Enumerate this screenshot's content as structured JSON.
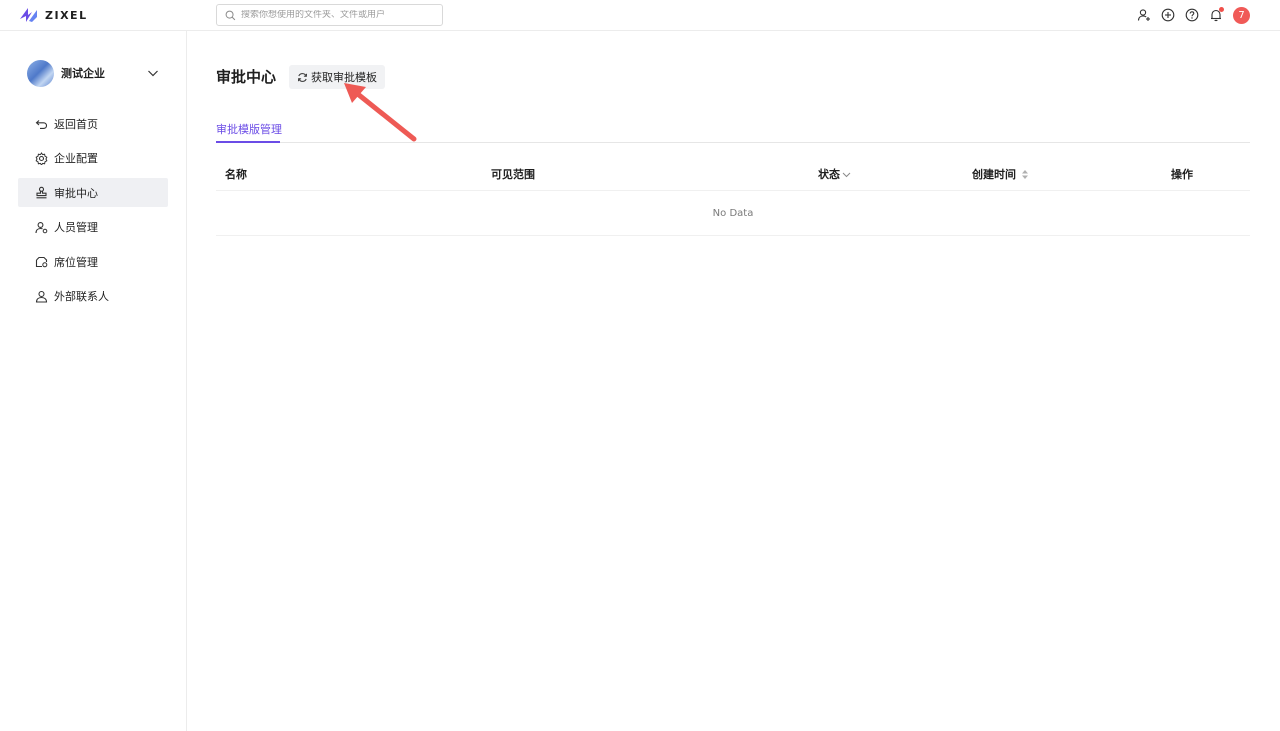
{
  "app": {
    "logo_text": "ZIXEL"
  },
  "search": {
    "placeholder": "搜索你想使用的文件夹、文件或用户"
  },
  "topbar": {
    "icons": [
      "add-user-icon",
      "plus-circle-icon",
      "help-icon",
      "bell-icon"
    ],
    "notification_count": "7"
  },
  "sidebar": {
    "org_name": "测试企业",
    "items": [
      {
        "label": "返回首页",
        "icon": "back-icon",
        "active": false
      },
      {
        "label": "企业配置",
        "icon": "gear-icon",
        "active": false
      },
      {
        "label": "审批中心",
        "icon": "stamp-icon",
        "active": true
      },
      {
        "label": "人员管理",
        "icon": "user-settings-icon",
        "active": false
      },
      {
        "label": "席位管理",
        "icon": "seat-icon",
        "active": false
      },
      {
        "label": "外部联系人",
        "icon": "contacts-icon",
        "active": false
      }
    ]
  },
  "main": {
    "title": "审批中心",
    "fetch_button": "获取审批模板",
    "tabs": [
      {
        "label": "审批模版管理",
        "active": true
      }
    ],
    "table": {
      "columns": [
        "名称",
        "可见范围",
        "状态",
        "创建时间",
        "操作"
      ],
      "empty_text": "No Data"
    }
  },
  "colors": {
    "accent": "#6b4ce6",
    "badge": "#f05a57",
    "arrow": "#ee5a55"
  }
}
